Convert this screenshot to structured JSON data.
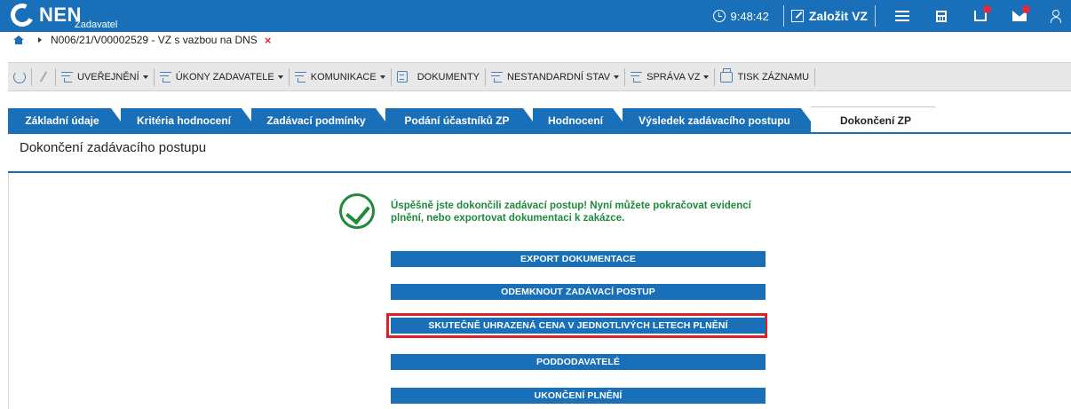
{
  "header": {
    "logo": "NEN",
    "logo_sub": "Zadavatel",
    "time": "9:48:42",
    "create_label": "Založit VZ",
    "icons": [
      "clock-icon",
      "edit-icon",
      "menu-icon",
      "calculator-icon",
      "inbox-icon",
      "mail-icon",
      "user-icon"
    ],
    "accent": "#1a70b8",
    "alert_color": "#e8283a"
  },
  "breadcrumb": {
    "path": "N006/21/V00002529 - VZ s vazbou na DNS",
    "close": "×"
  },
  "toolbar": {
    "uverejneni": "UVEŘEJNĚNÍ",
    "ukony": "ÚKONY ZADAVATELE",
    "komunikace": "KOMUNIKACE",
    "dokumenty": "DOKUMENTY",
    "nestandardni": "NESTANDARDNÍ STAV",
    "sprava": "SPRÁVA VZ",
    "tisk": "TISK ZÁZNAMU"
  },
  "tabs": [
    {
      "label": "Základní údaje"
    },
    {
      "label": "Kritéria hodnocení"
    },
    {
      "label": "Zadávací podmínky"
    },
    {
      "label": "Podání účastníků ZP"
    },
    {
      "label": "Hodnocení"
    },
    {
      "label": "Výsledek zadávacího postupu"
    },
    {
      "label": "Dokončení ZP"
    }
  ],
  "section": {
    "title": "Dokončení zadávacího postupu"
  },
  "success": {
    "message": "Úspěšně jste dokončili zadávací postup! Nyní můžete pokračovat evidencí plnění, nebo exportovat dokumentaci k zakázce.",
    "color": "#1f8a3b"
  },
  "buttons": {
    "export": "EXPORT DOKUMENTACE",
    "unlock": "ODEMKNOUT ZADÁVACÍ POSTUP",
    "price": "SKUTEČNĚ UHRAZENÁ CENA V JEDNOTLIVÝCH LETECH PLNĚNÍ",
    "subcontractors": "PODDODAVATELÉ",
    "end": "UKONČENÍ PLNĚNÍ",
    "highlight_color": "#e01e26"
  }
}
